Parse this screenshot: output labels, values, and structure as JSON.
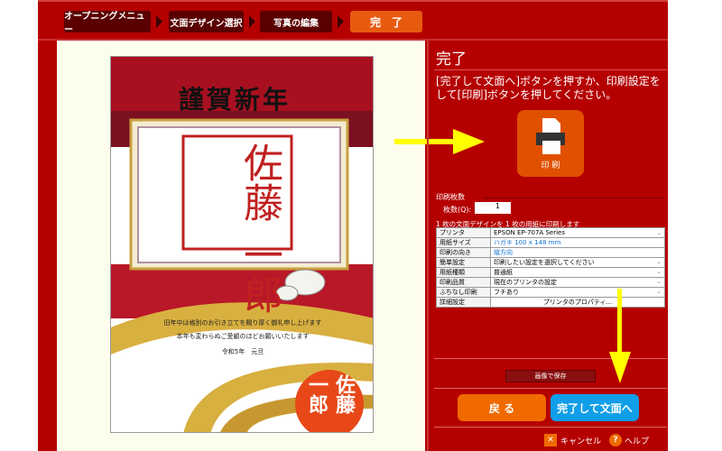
{
  "steps": [
    "オープニングメニュー",
    "文面デザイン選択",
    "写真の編集",
    "完　了"
  ],
  "card": {
    "title": "謹賀新年",
    "stamp": "佐藤 一郎",
    "message_line1": "旧年中は格別のお引き立てを賜り厚く御礼申し上げます",
    "message_line2": "本年も変わらぬご愛顧のほどお願いいたします",
    "date": "令和5年　元旦",
    "seal": "佐藤 一郎"
  },
  "panel": {
    "title": "完了",
    "description_line1": "[完了して文面へ]ボタンを押すか、印刷設定を",
    "description_line2": "して[印刷]ボタンを押してください。",
    "print_label": "印 刷",
    "copies_section": "印刷枚数",
    "copies_label": "枚数(Q):",
    "copies_value": "1",
    "layout_note": "1 枚の文面デザインを 1 枚の用紙に印刷します",
    "settings": [
      {
        "key": "プリンタ",
        "value": "EPSON EP-707A Series",
        "dropdown": true
      },
      {
        "key": "用紙サイズ",
        "value": "ハガキ 100 x 148 mm",
        "link": true
      },
      {
        "key": "印刷の向き",
        "value": "縦方向",
        "link": true
      },
      {
        "key": "簡単設定",
        "value": "印刷したい設定を選択してください",
        "dropdown": true
      },
      {
        "key": "用紙種類",
        "value": "普通紙",
        "dropdown": true
      },
      {
        "key": "印刷品質",
        "value": "現在のプリンタの設定",
        "dropdown": true
      },
      {
        "key": "ふちなし印刷",
        "value": "フチあり",
        "dropdown": true
      },
      {
        "key": "詳細設定",
        "value": "プリンタのプロパティ..."
      }
    ],
    "save_image": "画像で保存",
    "back": "戻 る",
    "finish": "完了して文面へ",
    "cancel": "キャンセル",
    "help": "ヘルプ"
  },
  "colors": {
    "bg": "#b50000",
    "accent": "#e86a00",
    "finish": "#109ee8",
    "arrow": "#ffff00"
  }
}
